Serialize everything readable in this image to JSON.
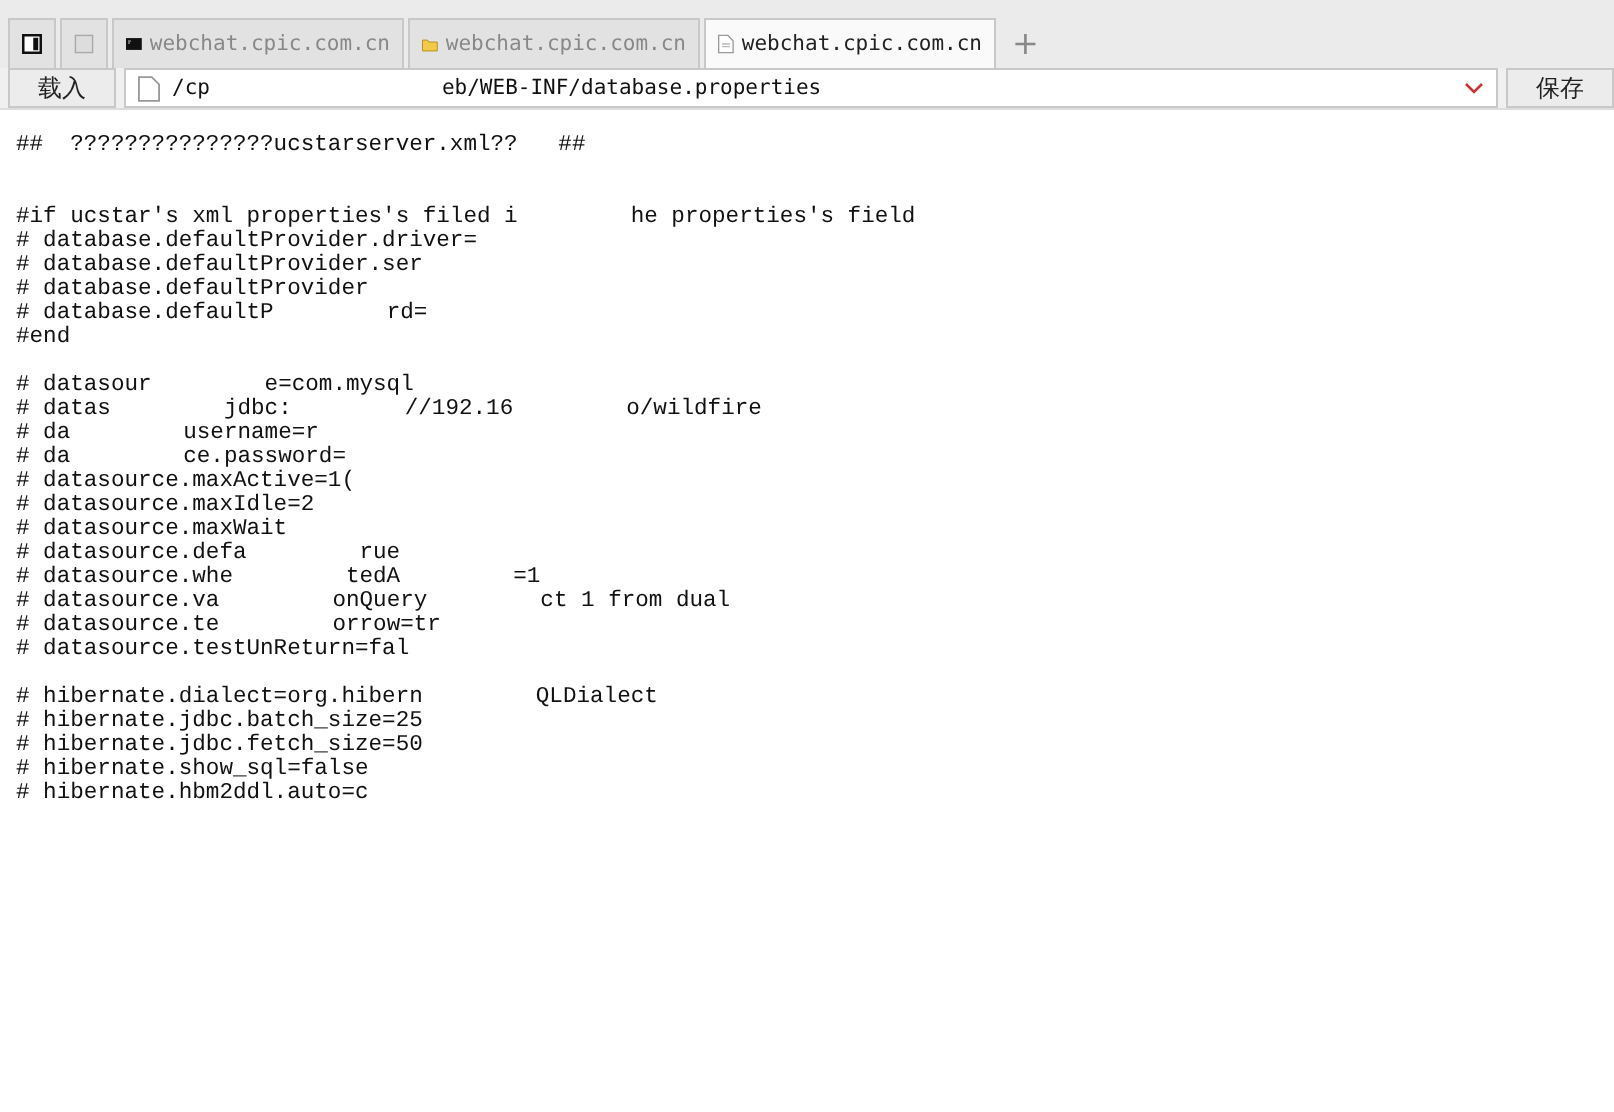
{
  "tabs": [
    {
      "kind": "panel",
      "selected": false
    },
    {
      "kind": "blank",
      "selected": false
    },
    {
      "kind": "terminal",
      "label": "webchat.cpic.com.cn",
      "selected": false
    },
    {
      "kind": "folder",
      "label": "webchat.cpic.com.cn",
      "selected": false
    },
    {
      "kind": "file",
      "label": "webchat.cpic.com.cn",
      "selected": true
    }
  ],
  "new_tab": "+",
  "address_bar": {
    "load_button": "载入",
    "path_parts": [
      "/cp",
      "eb/WEB-INF/database.properties"
    ],
    "save_button": "保存"
  },
  "editor": {
    "lines": [
      {
        "kind": "text",
        "parts": [
          "##  ???????????????ucstarserver.xml??   ##"
        ]
      },
      {
        "kind": "blank"
      },
      {
        "kind": "blank"
      },
      {
        "kind": "text",
        "parts": [
          "#if ucstar's xml properties's filed i",
          "he properties's field"
        ]
      },
      {
        "kind": "text",
        "parts": [
          "# database.defaultProvider.driver="
        ]
      },
      {
        "kind": "text",
        "parts": [
          "# database.defaultProvider.ser"
        ]
      },
      {
        "kind": "text",
        "parts": [
          "# database.defaultProvider"
        ]
      },
      {
        "kind": "text",
        "parts": [
          "# database.defaultP",
          "rd="
        ]
      },
      {
        "kind": "text",
        "parts": [
          "#end"
        ]
      },
      {
        "kind": "blank"
      },
      {
        "kind": "text",
        "parts": [
          "# datasour",
          "e=com.mysql"
        ]
      },
      {
        "kind": "text",
        "parts": [
          "# datas",
          "jdbc:",
          "//192.16",
          "o/wildfire"
        ]
      },
      {
        "kind": "text",
        "parts": [
          "# da",
          "username=r"
        ]
      },
      {
        "kind": "text",
        "parts": [
          "# da",
          "ce.password="
        ]
      },
      {
        "kind": "text",
        "parts": [
          "# datasource.maxActive=1("
        ]
      },
      {
        "kind": "text",
        "parts": [
          "# datasource.maxIdle=2"
        ]
      },
      {
        "kind": "text",
        "parts": [
          "# datasource.maxWait"
        ]
      },
      {
        "kind": "text",
        "parts": [
          "# datasource.defa",
          "rue"
        ]
      },
      {
        "kind": "text",
        "parts": [
          "# datasource.whe",
          "tedA",
          "=1"
        ]
      },
      {
        "kind": "text",
        "parts": [
          "# datasource.va",
          "onQuery",
          "ct 1 from dual"
        ]
      },
      {
        "kind": "text",
        "parts": [
          "# datasource.te",
          "orrow=tr"
        ]
      },
      {
        "kind": "text",
        "parts": [
          "# datasource.testUnReturn=fal"
        ]
      },
      {
        "kind": "blank"
      },
      {
        "kind": "text",
        "parts": [
          "# hibernate.dialect=org.hibern",
          "QLDialect"
        ]
      },
      {
        "kind": "text",
        "parts": [
          "# hibernate.jdbc.batch_size=25"
        ]
      },
      {
        "kind": "text",
        "parts": [
          "# hibernate.jdbc.fetch_size=50"
        ]
      },
      {
        "kind": "text",
        "parts": [
          "# hibernate.show_sql=false"
        ]
      },
      {
        "kind": "text",
        "parts": [
          "# hibernate.hbm2ddl.auto=c"
        ]
      }
    ]
  }
}
